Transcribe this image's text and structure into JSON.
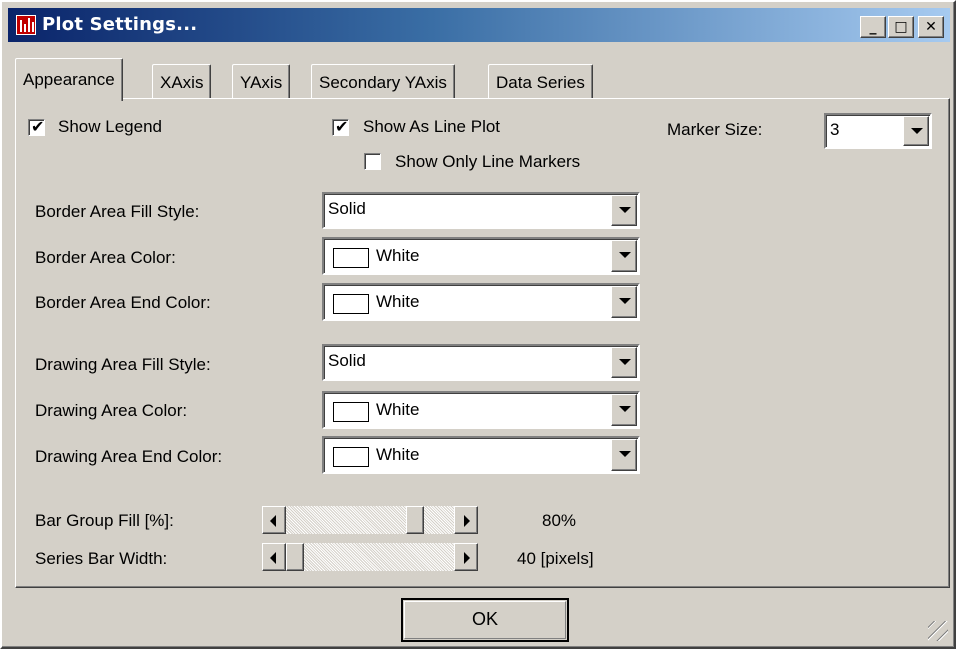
{
  "window": {
    "title": "Plot Settings..."
  },
  "titlebar_buttons": {
    "minimize": "_",
    "maximize": "□",
    "close": "✕"
  },
  "tabs": [
    {
      "label": "Appearance",
      "active": true
    },
    {
      "label": "XAxis",
      "active": false
    },
    {
      "label": "YAxis",
      "active": false
    },
    {
      "label": "Secondary YAxis",
      "active": false
    },
    {
      "label": "Data Series",
      "active": false
    }
  ],
  "options": {
    "show_legend": {
      "label": "Show Legend",
      "checked": true
    },
    "show_as_line_plot": {
      "label": "Show As Line Plot",
      "checked": true
    },
    "show_only_line_markers": {
      "label": "Show Only Line Markers",
      "checked": false
    },
    "marker_size": {
      "label": "Marker Size:",
      "value": "3"
    }
  },
  "border_area": {
    "fill_style": {
      "label": "Border Area Fill Style:",
      "value": "Solid"
    },
    "color": {
      "label": "Border Area Color:",
      "value": "White",
      "swatch": "#ffffff"
    },
    "end_color": {
      "label": "Border Area End Color:",
      "value": "White",
      "swatch": "#ffffff"
    }
  },
  "drawing_area": {
    "fill_style": {
      "label": "Drawing Area Fill Style:",
      "value": "Solid"
    },
    "color": {
      "label": "Drawing Area Color:",
      "value": "White",
      "swatch": "#ffffff"
    },
    "end_color": {
      "label": "Drawing Area End Color:",
      "value": "White",
      "swatch": "#ffffff"
    }
  },
  "bar_group_fill": {
    "label": "Bar Group Fill [%]:",
    "value_text": "80%",
    "level": 0.8
  },
  "series_bar_width": {
    "label": "Series Bar Width:",
    "value_text": "40 [pixels]",
    "level": 0.0
  },
  "footer": {
    "ok_label": "OK"
  },
  "colors": {
    "face": "#d4d0c8",
    "title_start": "#0a246a",
    "title_end": "#a6caf0"
  }
}
